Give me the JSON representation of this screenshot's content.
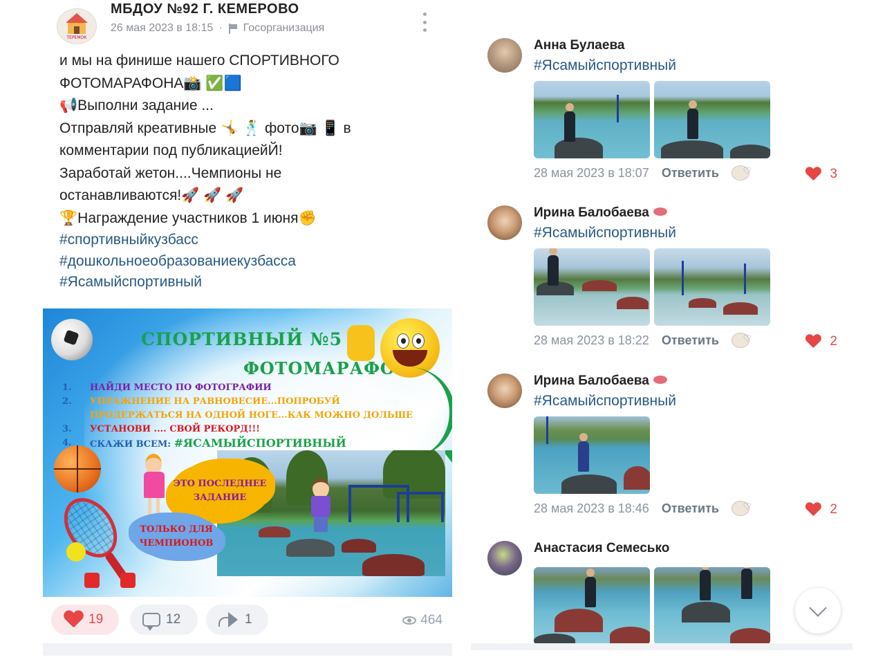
{
  "post": {
    "group_name": "МБДОУ №92 Г. КЕМЕРОВО",
    "date": "26 мая 2023 в 18:15",
    "separator": "·",
    "org_type": "Госорганизация",
    "avatar_caption": "ТЕРЕМОК",
    "text_lines": [
      "и мы на финише нашего СПОРТИВНОГО",
      "ФОТОМАРАФОНА📸 ✅🟦",
      "📢Выполни задание ...",
      "Отправляй креативные 🤸 🕺 фото📷 📱 в",
      "комментарии под публикациейЙ!",
      "Заработай жетон....Чемпионы не",
      "останавливаются!🚀 🚀 🚀",
      "🏆Награждение участников 1 июня✊"
    ],
    "hashtags": [
      "#спортивныйкузбасс",
      "#дошкольноеобразованиекузбасса",
      "#Ясамыйспортивный"
    ],
    "banner": {
      "title_part1": "СПОРТИВНЫЙ  №5",
      "title_part2": "ФОТОМАРАФОН",
      "items": [
        {
          "num": "1.",
          "text": "НАЙДИ МЕСТО ПО ФОТОГРАФИИ"
        },
        {
          "num": "2.",
          "text": "УПРАЖНЕНИЕ НА РАВНОВЕСИЕ...ПОПРОБУЙ ПРОДЕРЖАТЬСЯ НА ОДНОЙ НОГЕ...КАК МОЖНО ДОЛЬШЕ"
        },
        {
          "num": "3.",
          "text": "УСТАНОВИ .... СВОЙ РЕКОРД!!!"
        },
        {
          "num": "4.",
          "text": "СКАЖИ ВСЕМ: ",
          "tag": "#ЯСАМЫЙСПОРТИВНЫЙ"
        }
      ],
      "cloud1": "ЭТО ПОСЛЕДНЕЕ ЗАДАНИЕ",
      "cloud2": "ТОЛЬКО ДЛЯ ЧЕМПИОНОВ"
    },
    "actions": {
      "likes": "19",
      "comments": "12",
      "shares": "1",
      "views": "464"
    }
  },
  "comments": [
    {
      "name": "Анна Булаева",
      "badge": false,
      "hashtag": "#Ясамыйспортивный",
      "date": "28 мая 2023 в 18:07",
      "reply_label": "Ответить",
      "likes": "3",
      "photo_count": 2
    },
    {
      "name": "Ирина Балобаева",
      "badge": true,
      "hashtag": "#Ясамыйспортивный",
      "date": "28 мая 2023 в 18:22",
      "reply_label": "Ответить",
      "likes": "2",
      "photo_count": 2
    },
    {
      "name": "Ирина Балобаева",
      "badge": true,
      "hashtag": "#Ясамыйспортивный",
      "date": "28 мая 2023 в 18:46",
      "reply_label": "Ответить",
      "likes": "2",
      "photo_count": 1
    },
    {
      "name": "Анастасия Семесько",
      "badge": false,
      "hashtag": "",
      "date": "",
      "reply_label": "",
      "likes": "",
      "photo_count": 2
    }
  ],
  "colors": {
    "link": "#2a5885",
    "like_red": "#e64646",
    "meta_gray": "#8a939d",
    "banner_green": "#1aa14a"
  },
  "icons": [
    "more-icon",
    "flag-icon",
    "heart-icon",
    "comment-icon",
    "share-icon",
    "eye-icon",
    "chevron-down-icon"
  ]
}
